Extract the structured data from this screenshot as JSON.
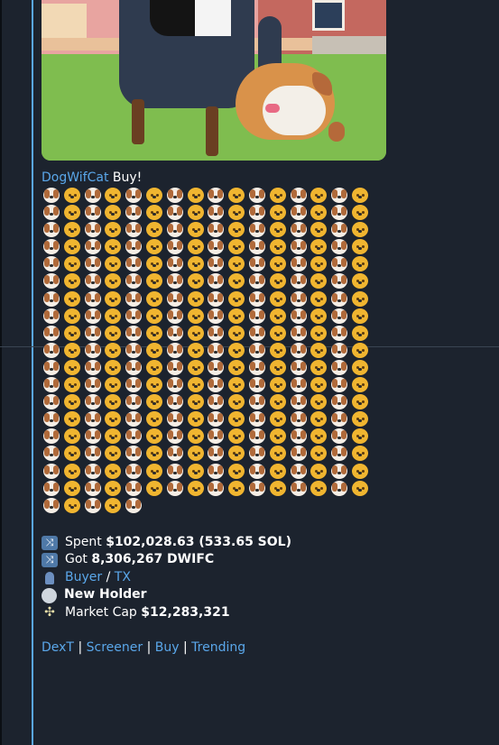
{
  "message": {
    "sender_name": "DogWifCat",
    "sender_suffix": "Buy!",
    "emoji_sequence": [
      "dog",
      "cat"
    ],
    "emoji_total": 293,
    "stats": {
      "spent_label": "Spent",
      "spent_value": "$102,028.63 (533.65 SOL)",
      "got_label": "Got",
      "got_value": "8,306,267 DWIFC",
      "buyer_link": "Buyer",
      "slash": "/",
      "tx_link": "TX",
      "new_holder": "New Holder",
      "market_cap_label": "Market Cap",
      "market_cap_value": "$12,283,321"
    },
    "footer_links": {
      "dext": "DexT",
      "screener": "Screener",
      "buy": "Buy",
      "trending": "Trending",
      "separator": "|"
    },
    "icons": {
      "spent": "shuffle-icon",
      "got": "shuffle-icon",
      "buyer": "person-icon",
      "holder": "globe-icon",
      "market_cap": "pin-icon"
    }
  },
  "colors": {
    "background": "#1c232e",
    "link": "#5aa7ea",
    "text": "#ffffff"
  }
}
